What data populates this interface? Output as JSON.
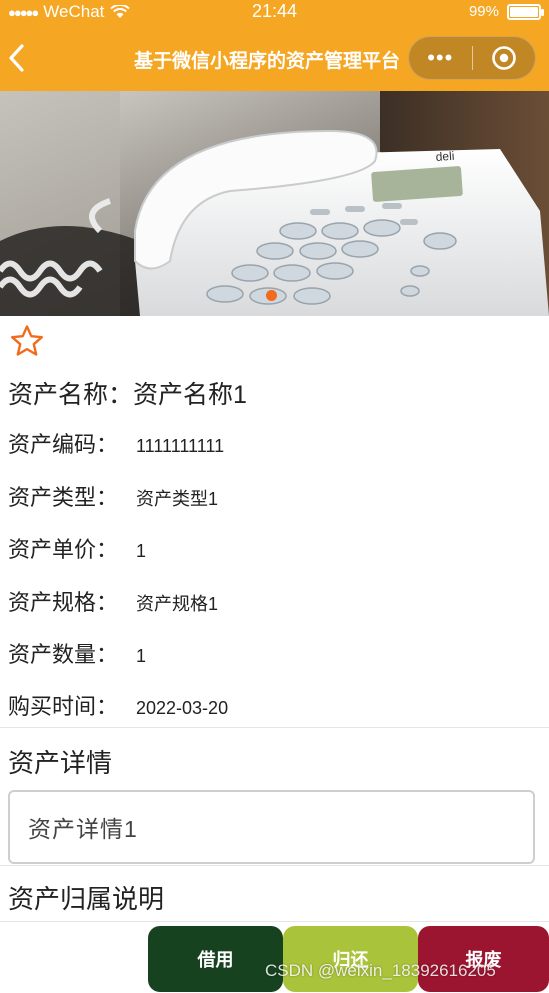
{
  "status_bar": {
    "signal_dots": "●●●●●",
    "carrier": "WeChat",
    "time": "21:44",
    "battery_level": "99%",
    "battery_fraction": 0.99
  },
  "nav": {
    "title": "基于微信小程序的资产管理平台",
    "more_label": "•••"
  },
  "asset": {
    "name_line": "资产名称：资产名称1",
    "fields": [
      {
        "label": "资产编码：",
        "value": "1111111111"
      },
      {
        "label": "资产类型：",
        "value": "资产类型1"
      },
      {
        "label": "资产单价：",
        "value": "1"
      },
      {
        "label": "资产规格：",
        "value": "资产规格1"
      },
      {
        "label": "资产数量：",
        "value": "1"
      },
      {
        "label": "购买时间：",
        "value": "2022-03-20"
      }
    ]
  },
  "details": {
    "title": "资产详情",
    "content": "资产详情1"
  },
  "ownership": {
    "title": "资产归属说明"
  },
  "actions": {
    "borrow": {
      "label": "借用",
      "color": "#17421f"
    },
    "return": {
      "label": "归还",
      "color": "#a9c43a"
    },
    "scrap": {
      "label": "报废",
      "color": "#9c1530"
    }
  },
  "colors": {
    "nav": "#f5a623",
    "star": "#f26b1d",
    "indicator": "#f26b1d"
  },
  "watermark": "CSDN @weixin_18392616205"
}
